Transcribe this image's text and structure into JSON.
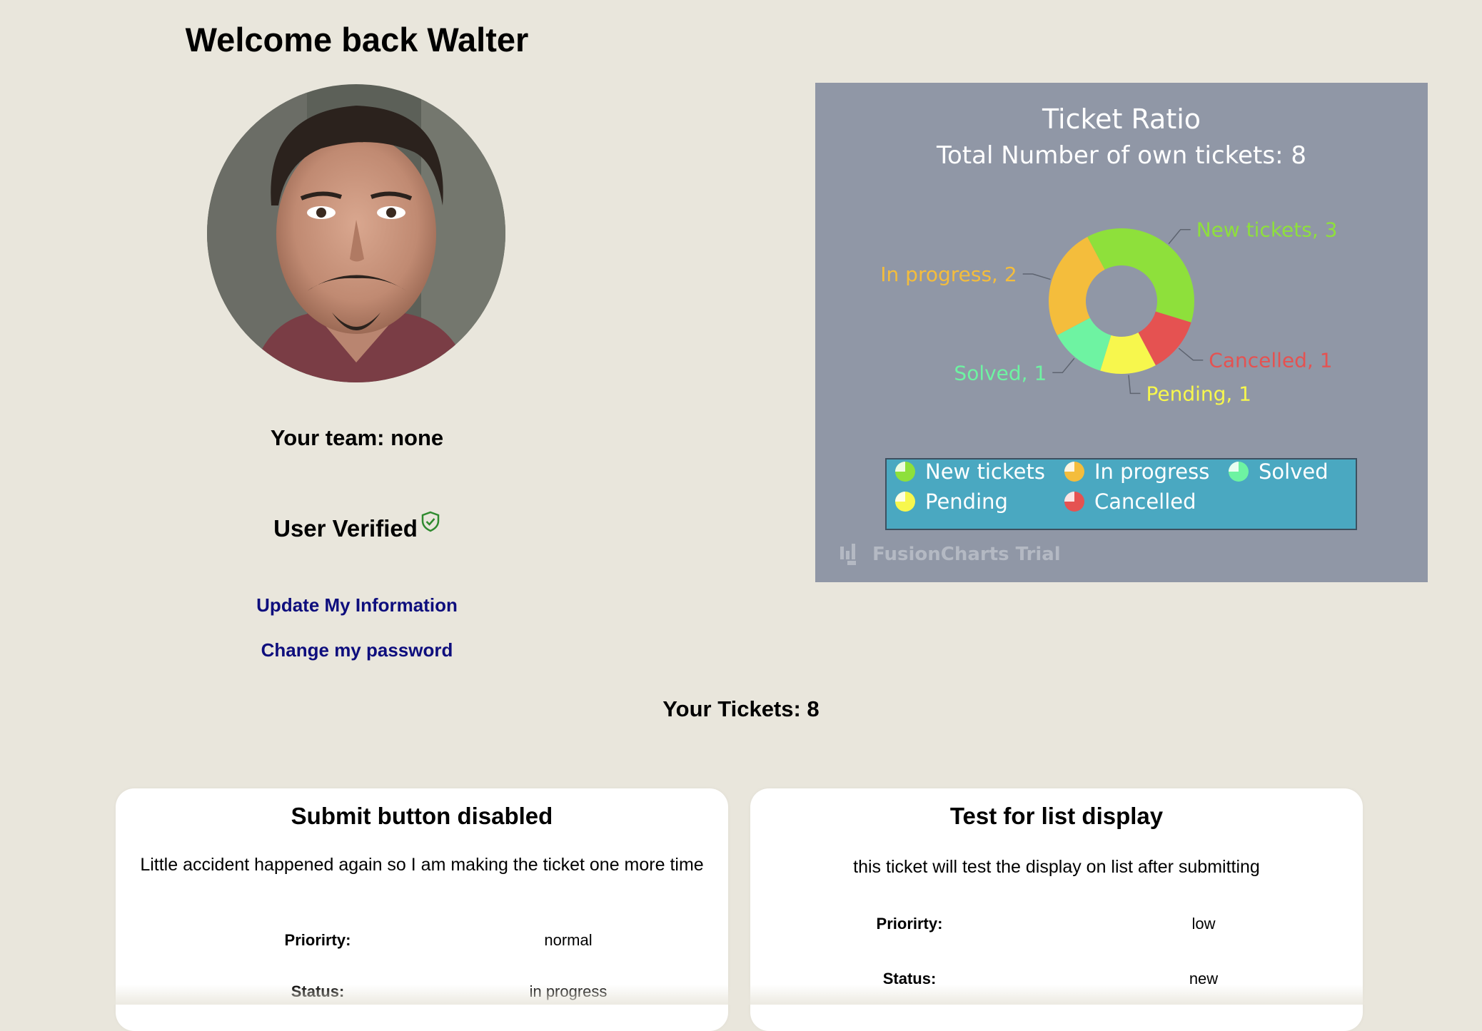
{
  "header": {
    "welcome": "Welcome back Walter"
  },
  "profile": {
    "team_text": "Your team: none",
    "verified_text": "User Verified",
    "update_link": "Update My Information",
    "password_link": "Change my password"
  },
  "tickets_summary": "Your Tickets: 8",
  "colors": {
    "page_bg": "#e9e6dc",
    "link": "#0e0e7d",
    "chart_bg": "#9097a6",
    "legend_bg": "#4aa8c1",
    "new_tickets": "#8ee03b",
    "in_progress": "#f4bd3c",
    "solved": "#6ef3a2",
    "pending": "#f7f74d",
    "cancelled": "#e55251",
    "verified_shield": "#2f8a2f"
  },
  "chart_data": {
    "type": "doughnut",
    "title": "Ticket Ratio",
    "subtitle": "Total Number of own tickets: 8",
    "slices": [
      {
        "label": "New tickets",
        "value": 3,
        "data_label": "New tickets, 3",
        "color": "#8ee03b"
      },
      {
        "label": "Cancelled",
        "value": 1,
        "data_label": "Cancelled, 1",
        "color": "#e55251"
      },
      {
        "label": "Pending",
        "value": 1,
        "data_label": "Pending, 1",
        "color": "#f7f74d"
      },
      {
        "label": "Solved",
        "value": 1,
        "data_label": "Solved, 1",
        "color": "#6ef3a2"
      },
      {
        "label": "In progress",
        "value": 2,
        "data_label": "In progress, 2",
        "color": "#f4bd3c"
      }
    ],
    "legend": [
      "New tickets",
      "In progress",
      "Solved",
      "Pending",
      "Cancelled"
    ],
    "legend_placement": "bottom",
    "watermark": "FusionCharts Trial"
  },
  "tickets": [
    {
      "title": "Submit button disabled",
      "description": "Little accident happened again so I am making the ticket one more time",
      "priority_label": "Priorirty:",
      "priority": "normal",
      "status_label": "Status:",
      "status": "in progress"
    },
    {
      "title": "Test for list display",
      "description": "this ticket will test the display on list after submitting",
      "priority_label": "Priorirty:",
      "priority": "low",
      "status_label": "Status:",
      "status": "new"
    }
  ]
}
